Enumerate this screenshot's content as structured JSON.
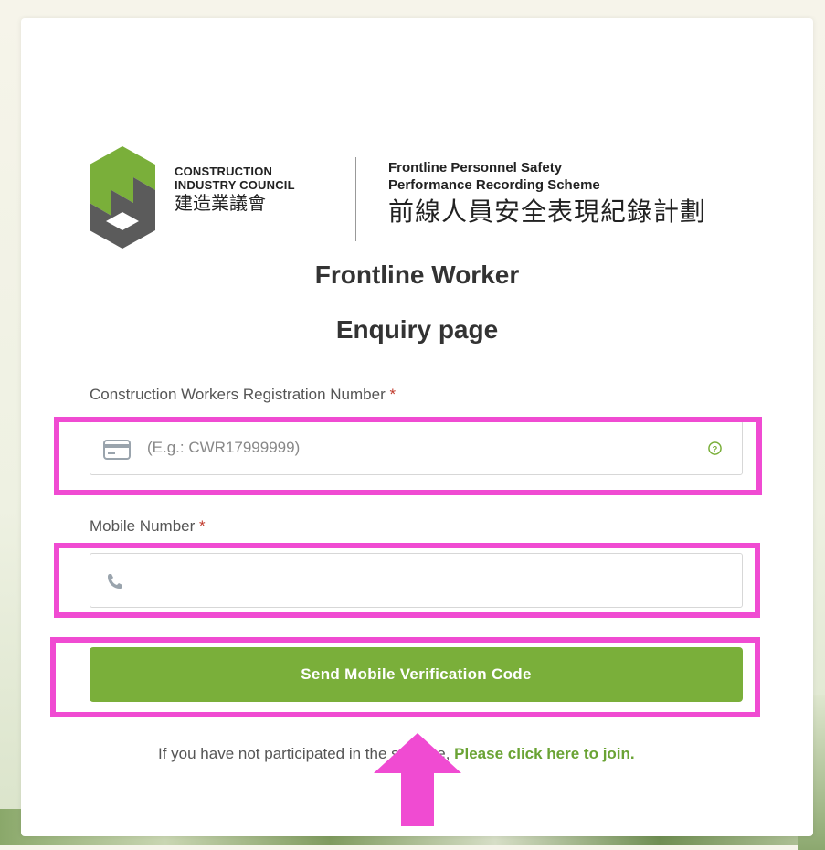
{
  "logo": {
    "org_en_line1": "CONSTRUCTION",
    "org_en_line2": "INDUSTRY COUNCIL",
    "org_zh": "建造業議會",
    "scheme_en_line1": "Frontline Personnel Safety",
    "scheme_en_line2": "Performance Recording Scheme",
    "scheme_zh": "前線人員安全表現紀錄計劃"
  },
  "page": {
    "title_line1": "Frontline Worker",
    "title_line2": "Enquiry page"
  },
  "form": {
    "registration_label": "Construction Workers Registration Number",
    "registration_placeholder": "(E.g.: CWR17999999)",
    "mobile_label": "Mobile Number",
    "mobile_placeholder": "",
    "required_mark": "*",
    "submit_label": "Send Mobile Verification Code"
  },
  "footer": {
    "join_prefix": "If you have not participated in the scheme,",
    "join_link": "Please click here to join."
  },
  "colors": {
    "accent": "#7aaf3a",
    "highlight": "#f04bd2",
    "required": "#c0392b"
  },
  "icons": [
    "id-card-icon",
    "help-circle-icon",
    "phone-icon",
    "cic-logo-mark",
    "annotation-arrow"
  ]
}
